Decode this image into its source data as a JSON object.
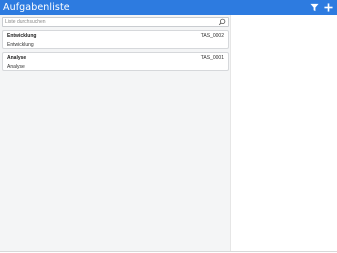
{
  "header": {
    "title": "Aufgabenliste",
    "filter_icon": "filter-icon",
    "add_icon": "plus-icon",
    "accent_color": "#2d7be0"
  },
  "search": {
    "placeholder": "Liste durchsuchen",
    "value": "",
    "icon": "search-icon"
  },
  "tasks": [
    {
      "name": "Entwicklung",
      "code": "TAS_0002",
      "description": "Entwicklung"
    },
    {
      "name": "Analyse",
      "code": "TAS_0001",
      "description": "Analyse"
    }
  ]
}
